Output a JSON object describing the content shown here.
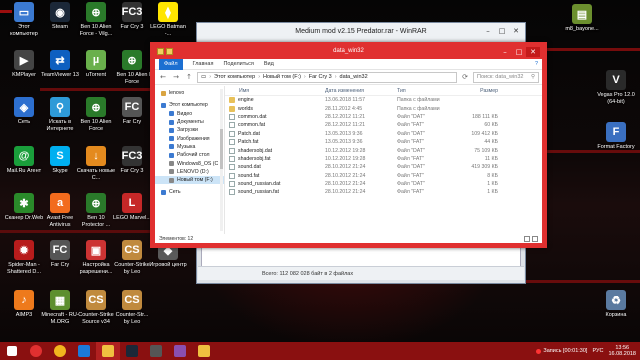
{
  "desktop_icons_left": [
    {
      "label": "Этот компьютер",
      "color": "#3b7ad1",
      "glyph": "▭"
    },
    {
      "label": "Steam",
      "color": "#1b2838",
      "glyph": "◉"
    },
    {
      "label": "Ben 10 Alien Force - Vilg...",
      "color": "#2a7a2a",
      "glyph": "⊕"
    },
    {
      "label": "Far Cry 3",
      "color": "#333333",
      "glyph": "FC3"
    },
    {
      "label": "LEGO Batman -...",
      "color": "#ffe500",
      "glyph": "⧫"
    },
    {
      "label": "KMPlayer",
      "color": "#444444",
      "glyph": "▶"
    },
    {
      "label": "TeamViewer 13",
      "color": "#0e5fc0",
      "glyph": "⇄"
    },
    {
      "label": "uTorrent",
      "color": "#6ab04c",
      "glyph": "µ"
    },
    {
      "label": "Ben 10 Alien Force",
      "color": "#2a7a2a",
      "glyph": "⊕"
    },
    {
      "label": "LEGO Marvel...",
      "color": "#c62828",
      "glyph": "L"
    },
    {
      "label": "Сеть",
      "color": "#2d6fcf",
      "glyph": "◈"
    },
    {
      "label": "Искать в Интернете",
      "color": "#2e9ad8",
      "glyph": "⚲"
    },
    {
      "label": "Ben 10 Alien Force",
      "color": "#2a7a2a",
      "glyph": "⊕"
    },
    {
      "label": "Far Cry",
      "color": "#555555",
      "glyph": "FC"
    },
    {
      "label": "Lego Marvel Super Heroes",
      "color": "#c62828",
      "glyph": "L"
    },
    {
      "label": "Mail.Ru Агент",
      "color": "#1a9e3b",
      "glyph": "@"
    },
    {
      "label": "Skype",
      "color": "#00aff0",
      "glyph": "S"
    },
    {
      "label": "Скачать новые С...",
      "color": "#e48a1e",
      "glyph": "↓"
    },
    {
      "label": "Far Cry 3",
      "color": "#333333",
      "glyph": "FC3"
    },
    {
      "label": "Bandicam",
      "color": "#444444",
      "glyph": "◍"
    },
    {
      "label": "Сканер Dr.Web",
      "color": "#2a8a2a",
      "glyph": "✱"
    },
    {
      "label": "Avast Free Antivirus",
      "color": "#f26b1d",
      "glyph": "a"
    },
    {
      "label": "Ben 10 Protector ...",
      "color": "#2a7a2a",
      "glyph": "⊕"
    },
    {
      "label": "LEGO Marvel...",
      "color": "#c62828",
      "glyph": "L"
    },
    {
      "label": "Prototype",
      "color": "#7a1a1a",
      "glyph": "P"
    },
    {
      "label": "Spider-Man - Shattered D...",
      "color": "#b71c1c",
      "glyph": "✹"
    },
    {
      "label": "Far Cry",
      "color": "#555555",
      "glyph": "FC"
    },
    {
      "label": "Настройка разрешени...",
      "color": "#cc3333",
      "glyph": "▣"
    },
    {
      "label": "Counter-Strike by Leo",
      "color": "#c08a3e",
      "glyph": "CS"
    },
    {
      "label": "Игровой центр",
      "color": "#5a5a5a",
      "glyph": "◆"
    },
    {
      "label": "AIMP3",
      "color": "#ee7a1c",
      "glyph": "♪"
    },
    {
      "label": "Minecraft - RU-M.ORG",
      "color": "#5d8f2e",
      "glyph": "▦"
    },
    {
      "label": "Counter-Strike Source v34",
      "color": "#c08a3e",
      "glyph": "CS"
    },
    {
      "label": "Counter-Str... by Leo",
      "color": "#c08a3e",
      "glyph": "CS"
    }
  ],
  "desktop_icons_right": [
    {
      "label": "m8_bayone...",
      "color": "#6b8f2e",
      "glyph": "▤"
    },
    {
      "label": "Vegas Pro 12.0 (64-bit)",
      "color": "#2a2a2a",
      "glyph": "V"
    },
    {
      "label": "Format Factory",
      "color": "#3a6fc0",
      "glyph": "F"
    },
    {
      "label": "Корзина",
      "color": "#5a7aa0",
      "glyph": "♻"
    }
  ],
  "winrar": {
    "title": "Medium mod v2.15 Predator.rar - WinRAR",
    "status": "Всего: 112 082 028 байт в 2 файлах"
  },
  "explorer": {
    "title": "data_win32",
    "ribbon": {
      "file": "Файл",
      "tabs": [
        "Главная",
        "Поделиться",
        "Вид"
      ],
      "help": "?"
    },
    "path": [
      "Этот компьютер",
      "Новый том (F:)",
      "Far Cry 3",
      "data_win32"
    ],
    "search_placeholder": "Поиск: data_win32",
    "nav": [
      {
        "label": "lenovo",
        "sub": false,
        "sel": false,
        "color": "#d9a441"
      },
      {
        "label": "Этот компьютер",
        "sub": false,
        "sel": false,
        "color": "#3b7ad1"
      },
      {
        "label": "Видео",
        "sub": true,
        "sel": false,
        "color": "#3b7ad1"
      },
      {
        "label": "Документы",
        "sub": true,
        "sel": false,
        "color": "#3b7ad1"
      },
      {
        "label": "Загрузки",
        "sub": true,
        "sel": false,
        "color": "#3b7ad1"
      },
      {
        "label": "Изображения",
        "sub": true,
        "sel": false,
        "color": "#3b7ad1"
      },
      {
        "label": "Музыка",
        "sub": true,
        "sel": false,
        "color": "#3b7ad1"
      },
      {
        "label": "Рабочий стол",
        "sub": true,
        "sel": false,
        "color": "#3b7ad1"
      },
      {
        "label": "Windows8_OS (C",
        "sub": true,
        "sel": false,
        "color": "#888888"
      },
      {
        "label": "LENOVO (D:)",
        "sub": true,
        "sel": false,
        "color": "#888888"
      },
      {
        "label": "Новый том (F:)",
        "sub": true,
        "sel": true,
        "color": "#888888"
      },
      {
        "label": "Сеть",
        "sub": false,
        "sel": false,
        "color": "#3b7ad1"
      }
    ],
    "columns": {
      "name": "Имя",
      "date": "Дата изменения",
      "type": "Тип",
      "size": "Размер"
    },
    "files": [
      {
        "name": "engine",
        "date": "13.06.2018 11:57",
        "type": "Папка с файлами",
        "size": "",
        "kind": "folder"
      },
      {
        "name": "worlds",
        "date": "28.11.2012 4:45",
        "type": "Папка с файлами",
        "size": "",
        "kind": "folder"
      },
      {
        "name": "common.dat",
        "date": "28.12.2012 11:21",
        "type": "Файл \"DAT\"",
        "size": "188 111 КБ",
        "kind": "file"
      },
      {
        "name": "common.fat",
        "date": "28.12.2012 11:21",
        "type": "Файл \"FAT\"",
        "size": "60 КБ",
        "kind": "file"
      },
      {
        "name": "Patch.dat",
        "date": "13.05.2013 9:36",
        "type": "Файл \"DAT\"",
        "size": "109 412 КБ",
        "kind": "file"
      },
      {
        "name": "Patch.fat",
        "date": "13.05.2013 9:36",
        "type": "Файл \"FAT\"",
        "size": "44 КБ",
        "kind": "file"
      },
      {
        "name": "shadersobj.dat",
        "date": "10.12.2012 19:28",
        "type": "Файл \"DAT\"",
        "size": "75 109 КБ",
        "kind": "file"
      },
      {
        "name": "shadersobj.fat",
        "date": "10.12.2012 19:28",
        "type": "Файл \"FAT\"",
        "size": "11 КБ",
        "kind": "file"
      },
      {
        "name": "sound.dat",
        "date": "28.10.2012 21:24",
        "type": "Файл \"DAT\"",
        "size": "419 309 КБ",
        "kind": "file"
      },
      {
        "name": "sound.fat",
        "date": "28.10.2012 21:24",
        "type": "Файл \"FAT\"",
        "size": "8 КБ",
        "kind": "file"
      },
      {
        "name": "sound_russian.dat",
        "date": "28.10.2012 21:24",
        "type": "Файл \"DAT\"",
        "size": "1 КБ",
        "kind": "file"
      },
      {
        "name": "sound_russian.fat",
        "date": "28.10.2012 21:24",
        "type": "Файл \"FAT\"",
        "size": "1 КБ",
        "kind": "file"
      }
    ],
    "status": "Элементов: 12"
  },
  "taskbar": {
    "apps": [
      {
        "name": "windows",
        "color": "#ffffff"
      },
      {
        "name": "yandex",
        "color": "#e03030"
      },
      {
        "name": "chrome",
        "color": "#f2b51e"
      },
      {
        "name": "ie",
        "color": "#1c7ad9"
      },
      {
        "name": "explorer",
        "color": "#f0c040"
      },
      {
        "name": "steam",
        "color": "#1b2838"
      },
      {
        "name": "farcry",
        "color": "#555555"
      },
      {
        "name": "winrar",
        "color": "#8a4fb0"
      },
      {
        "name": "folder",
        "color": "#f0c040"
      }
    ],
    "record": "Запись [00:01:30]",
    "lang": "РУС",
    "time": "13:56",
    "date": "16.08.2018"
  }
}
